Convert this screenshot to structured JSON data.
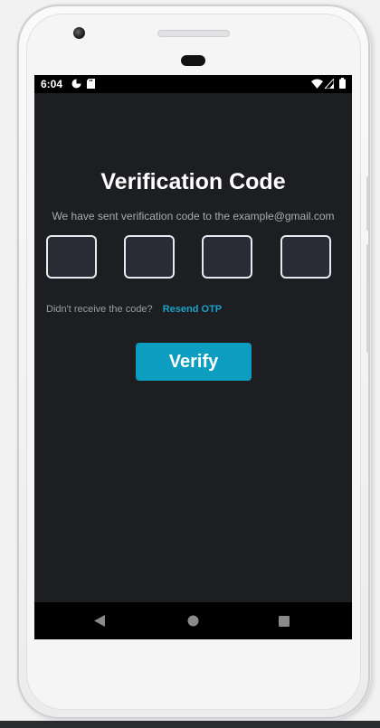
{
  "statusbar": {
    "time": "6:04",
    "icons": [
      "app-notification-icon",
      "sd-card-icon",
      "wifi-icon",
      "signal-icon",
      "battery-icon"
    ]
  },
  "verification": {
    "title": "Verification Code",
    "subtitle": "We have sent verification code to the example@gmail.com",
    "otp_values": [
      "",
      "",
      "",
      ""
    ],
    "resend_prompt": "Didn't receive the code?",
    "resend_link": "Resend OTP",
    "verify_label": "Verify"
  },
  "navbar": {
    "buttons": [
      "back-icon",
      "home-icon",
      "recents-icon"
    ]
  },
  "colors": {
    "screen_bg": "#1d1e22",
    "accent": "#0d9dc1",
    "link": "#1aa1c8",
    "otp_box_bg": "#2a2c35"
  }
}
